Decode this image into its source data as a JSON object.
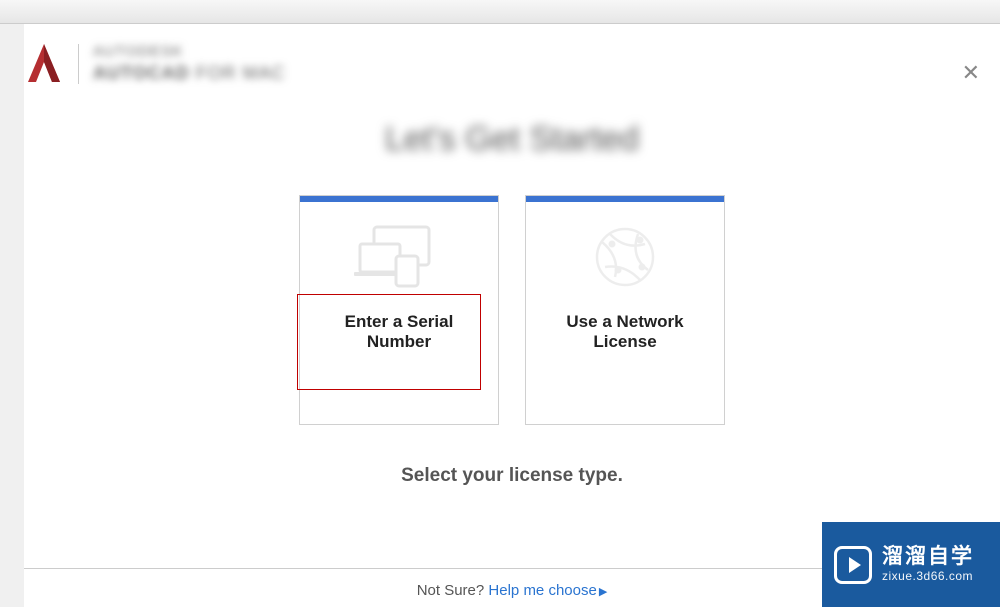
{
  "header": {
    "brand_line1": "AUTODESK",
    "brand_line2_bold": "AUTOCAD",
    "brand_line2_rest": " FOR MAC"
  },
  "page": {
    "headline": "Let's Get Started",
    "instruction": "Select your license type."
  },
  "cards": {
    "serial": {
      "label_line1": "Enter a Serial",
      "label_line2": "Number"
    },
    "network": {
      "label_line1": "Use a Network",
      "label_line2": "License"
    }
  },
  "footer": {
    "prefix": "Not Sure? ",
    "link": "Help me choose"
  },
  "watermark": {
    "cn": "溜溜自学",
    "url": "zixue.3d66.com"
  }
}
